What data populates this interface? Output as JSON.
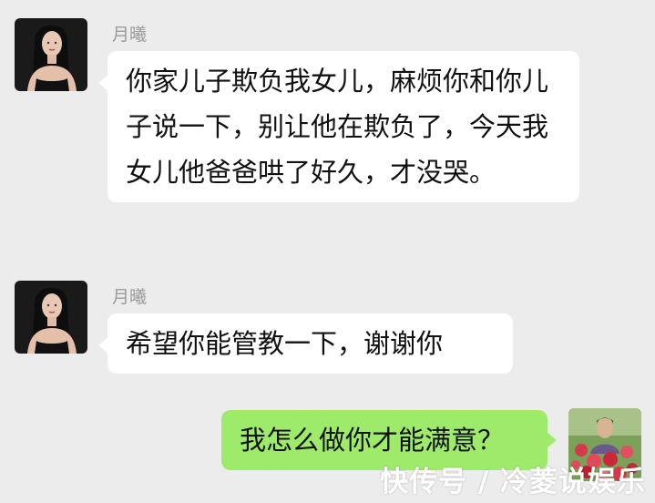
{
  "messages": [
    {
      "sender": "月曦",
      "side": "left",
      "text": "你家儿子欺负我女儿，麻烦你和你儿子说一下，别让他在欺负了，今天我女儿他爸爸哄了好久，才没哭。"
    },
    {
      "sender": "月曦",
      "side": "left",
      "text": "希望你能管教一下，谢谢你"
    },
    {
      "sender": "",
      "side": "right",
      "text": "我怎么做你才能满意？"
    }
  ],
  "watermark": "快传号 / 冷菱说娱乐",
  "colors": {
    "background": "#ececec",
    "incoming_bubble": "#ffffff",
    "outgoing_bubble": "#9eea6a",
    "sender_name": "#9a9a9a"
  },
  "icons": {
    "avatar_left": "woman-portrait-avatar",
    "avatar_right": "flowers-portrait-avatar"
  }
}
